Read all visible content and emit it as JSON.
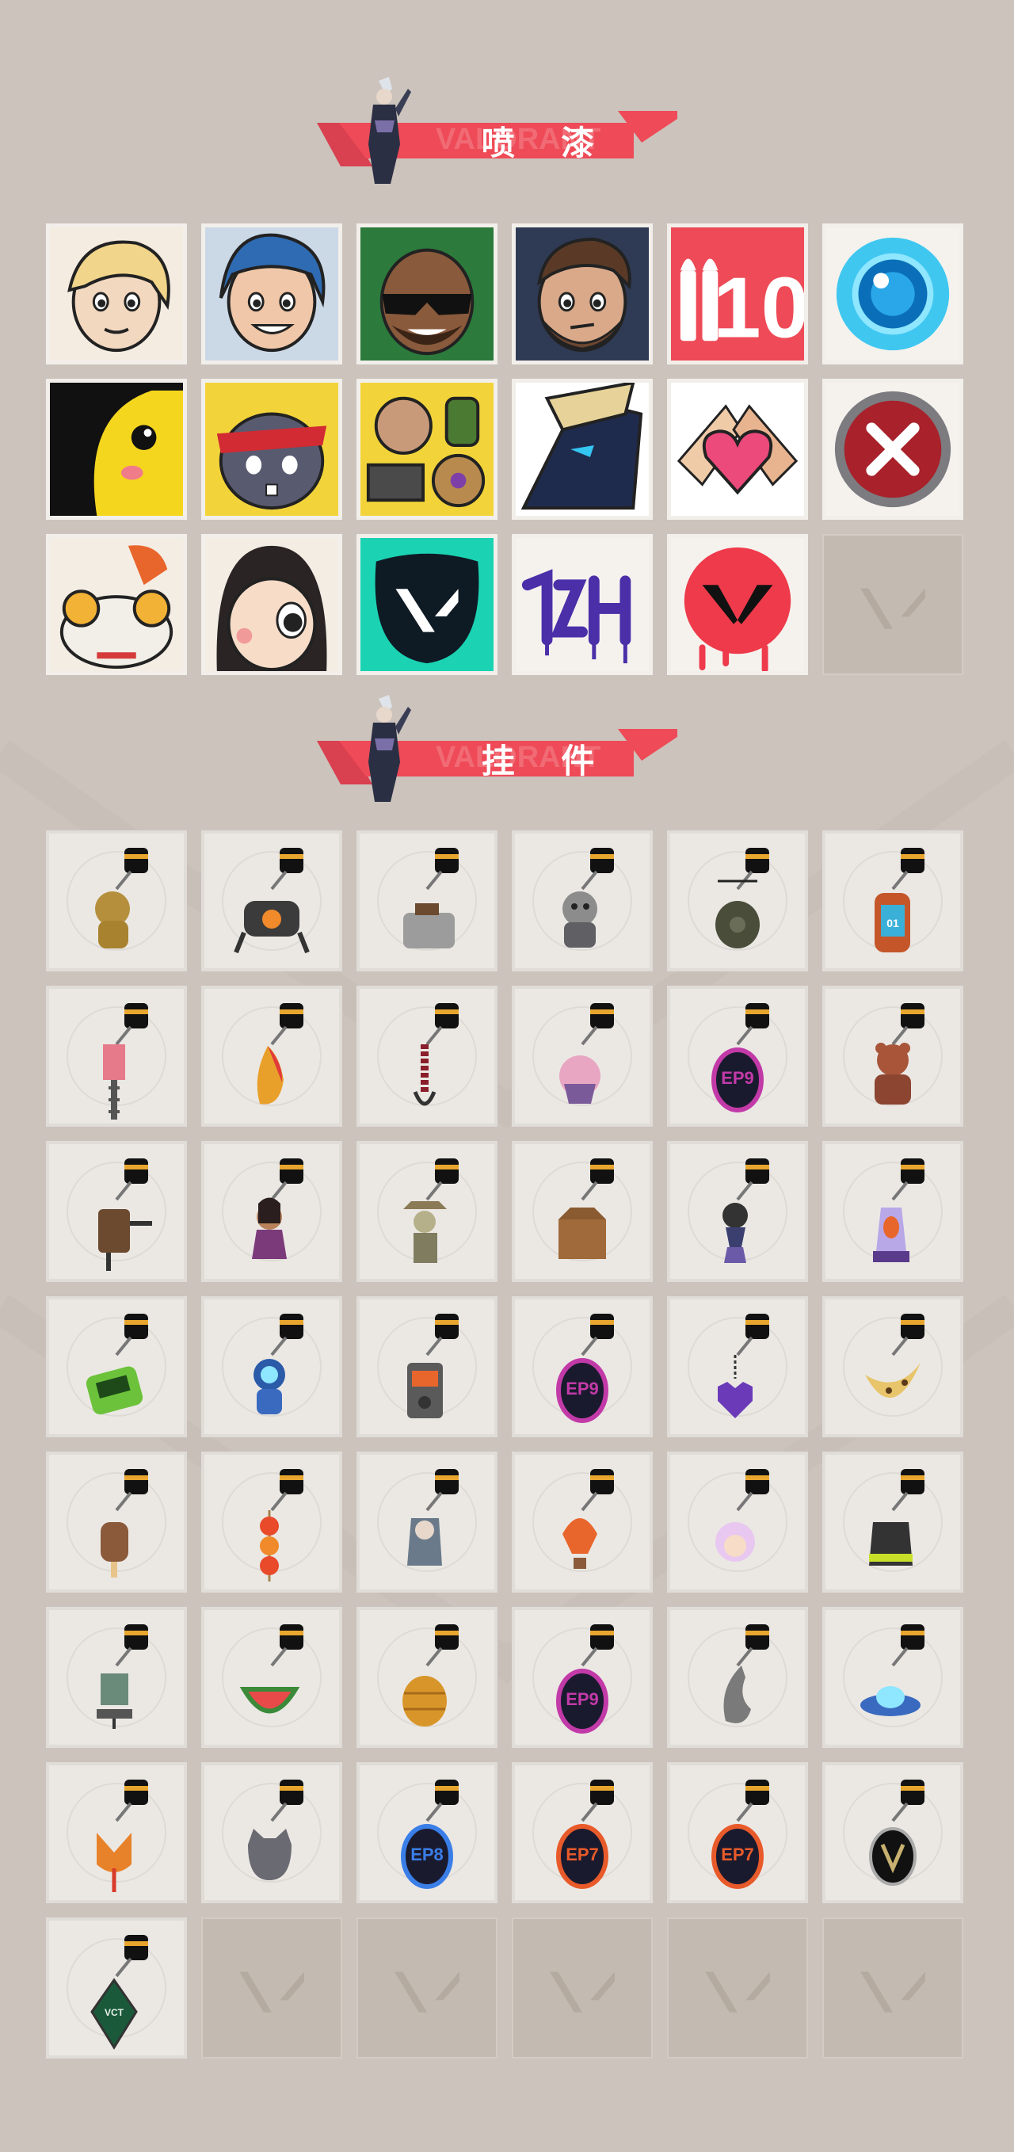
{
  "sections": {
    "sprays": {
      "title": "喷 漆",
      "watermark": "VALORANT"
    },
    "buddies": {
      "title": "挂 件",
      "watermark": "VALORANT"
    }
  },
  "colors": {
    "background": "#cbc3bc",
    "banner": "#ee4a57",
    "tile": "#ebe8e4",
    "empty": "#c3bab1"
  },
  "sprays": [
    {
      "icon": "blonde-agent-face-icon"
    },
    {
      "icon": "blue-hood-agent-face-icon"
    },
    {
      "icon": "sunglasses-agent-face-icon"
    },
    {
      "icon": "smirking-bearded-agent-face-icon"
    },
    {
      "icon": "ammo-number-ten-icon",
      "text": "10"
    },
    {
      "icon": "blue-orb-icon"
    },
    {
      "icon": "yellow-creature-icon"
    },
    {
      "icon": "headband-animal-icon"
    },
    {
      "icon": "fists-collage-icon"
    },
    {
      "icon": "masked-agent-icon"
    },
    {
      "icon": "heart-hands-icon"
    },
    {
      "icon": "close-x-badge-icon"
    },
    {
      "icon": "dragon-creature-icon"
    },
    {
      "icon": "chibi-girl-face-icon"
    },
    {
      "icon": "valorant-logo-splash-icon"
    },
    {
      "icon": "graffiti-tag-icon"
    },
    {
      "icon": "red-valorant-drip-icon"
    },
    {
      "icon": "empty-slot",
      "empty": true
    }
  ],
  "buddies": [
    {
      "icon": "gold-cat-charm-icon"
    },
    {
      "icon": "drone-charm-icon"
    },
    {
      "icon": "toaster-charm-icon"
    },
    {
      "icon": "armored-cat-charm-icon"
    },
    {
      "icon": "bag-charm-icon"
    },
    {
      "icon": "canister-charm-icon",
      "text": "01"
    },
    {
      "icon": "chainsaw-charm-icon"
    },
    {
      "icon": "pepper-charm-icon"
    },
    {
      "icon": "braided-rope-charm-icon"
    },
    {
      "icon": "cupcake-charm-icon"
    },
    {
      "icon": "ep9-medallion-icon",
      "text": "EP9"
    },
    {
      "icon": "teddy-bear-charm-icon"
    },
    {
      "icon": "handle-charm-icon"
    },
    {
      "icon": "agent-doll-charm-icon"
    },
    {
      "icon": "cowboy-robot-charm-icon"
    },
    {
      "icon": "box-creature-charm-icon"
    },
    {
      "icon": "scarecrow-charm-icon"
    },
    {
      "icon": "lava-lamp-charm-icon"
    },
    {
      "icon": "pager-charm-icon"
    },
    {
      "icon": "astronaut-charm-icon"
    },
    {
      "icon": "radio-charm-icon"
    },
    {
      "icon": "ep9-medallion-icon",
      "text": "EP9"
    },
    {
      "icon": "pixel-heart-charm-icon"
    },
    {
      "icon": "cookie-charm-icon"
    },
    {
      "icon": "ice-pop-charm-icon"
    },
    {
      "icon": "tanghulu-charm-icon"
    },
    {
      "icon": "agent-figure-charm-icon"
    },
    {
      "icon": "hot-air-balloon-charm-icon"
    },
    {
      "icon": "anime-girl-charm-icon"
    },
    {
      "icon": "device-charm-icon"
    },
    {
      "icon": "robot-charm-icon"
    },
    {
      "icon": "watermelon-charm-icon"
    },
    {
      "icon": "beehive-charm-icon"
    },
    {
      "icon": "ep9-medallion-icon",
      "text": "EP9"
    },
    {
      "icon": "claw-charm-icon"
    },
    {
      "icon": "ufo-charm-icon"
    },
    {
      "icon": "fox-charm-icon"
    },
    {
      "icon": "cat-head-charm-icon"
    },
    {
      "icon": "ep8-medallion-icon",
      "text": "EP8"
    },
    {
      "icon": "ep7-medallion-icon",
      "text": "EP7"
    },
    {
      "icon": "ep7-medallion-icon",
      "text": "EP7"
    },
    {
      "icon": "v-medallion-icon"
    },
    {
      "icon": "gem-charm-icon",
      "text": "VCT"
    },
    {
      "icon": "empty-slot",
      "empty": true
    },
    {
      "icon": "empty-slot",
      "empty": true
    },
    {
      "icon": "empty-slot",
      "empty": true
    },
    {
      "icon": "empty-slot",
      "empty": true
    },
    {
      "icon": "empty-slot",
      "empty": true
    }
  ]
}
